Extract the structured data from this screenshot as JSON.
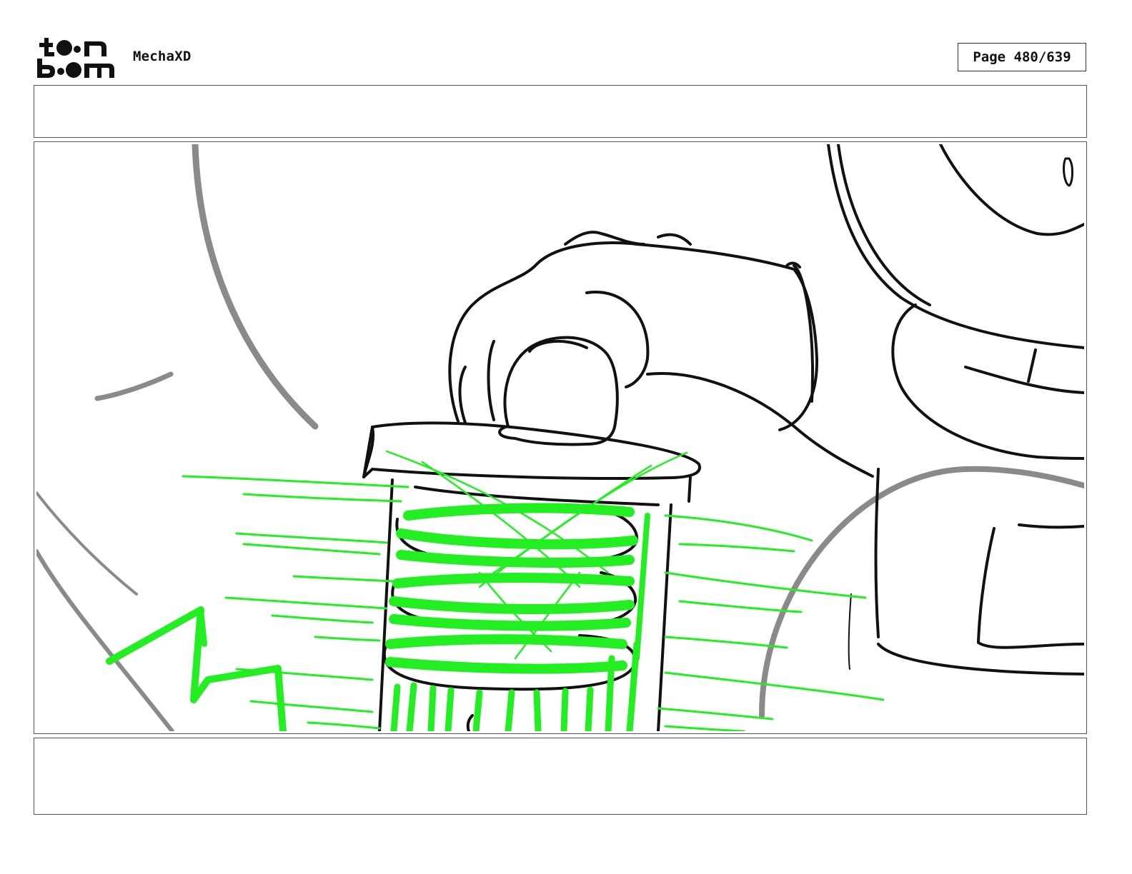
{
  "header": {
    "logo": {
      "name": "toonboom-logo",
      "top_text": "toon",
      "bottom_text": "boom"
    },
    "project_title": "MechaXD",
    "page_label": "Page 480/639"
  },
  "panel": {
    "top_notes": "",
    "bottom_notes": "",
    "sketch_colors": {
      "ink": "#111111",
      "background_guides": "#8a8a8a",
      "energy_effect": "#22ee22"
    }
  }
}
